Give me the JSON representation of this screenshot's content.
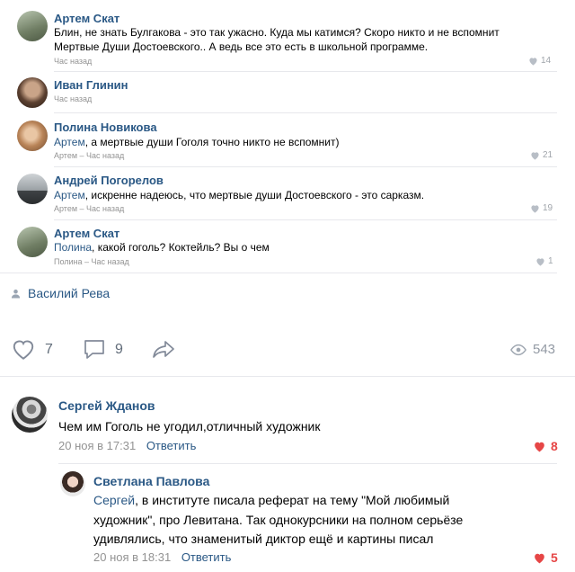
{
  "thread": [
    {
      "author": "Артем Скат",
      "text_line1": "Блин, не знать Булгакова - это так ужасно. Куда мы катимся? Скоро никто и не вспомнит",
      "text_line2": "Мертвые Души Достоевского.. А ведь все это есть в школьной программе.",
      "meta": "Час назад",
      "likes": "14"
    },
    {
      "author": "Иван Глинин",
      "meta": "Час назад"
    },
    {
      "author": "Полина Новикова",
      "reply_to": "Артем",
      "text": ", а мертвые души Гоголя точно никто не вспомнит)",
      "meta": "Артем – Час назад",
      "likes": "21"
    },
    {
      "author": "Андрей Погорелов",
      "reply_to": "Артем",
      "text": ", искренне надеюсь, что мертвые души Достоевского - это сарказм.",
      "meta": "Артем – Час назад",
      "likes": "19"
    },
    {
      "author": "Артем Скат",
      "reply_to": "Полина",
      "text": ", какой гоголь? Коктейль? Вы о чем",
      "meta": "Полина – Час назад",
      "likes": "1"
    }
  ],
  "post_author": "Василий Рева",
  "post_actions": {
    "likes": "7",
    "comments": "9",
    "views": "543"
  },
  "comments": [
    {
      "author": "Сергей Жданов",
      "text": "Чем им Гоголь не угодил,отличный художник",
      "date": "20 ноя в 17:31",
      "reply_label": "Ответить",
      "likes": "8"
    },
    {
      "author": "Светлана Павлова",
      "reply_to": "Сергей",
      "text_line1": ", в институте писала реферат на тему \"Мой любимый",
      "text_line2": "художник\", про Левитана. Так однокурсники на полном серьёзе",
      "text_line3": "удивлялись, что знаменитый диктор ещё и картины писал",
      "date": "20 ноя в 18:31",
      "reply_label": "Ответить",
      "likes": "5"
    }
  ],
  "colors": {
    "link": "#2a5885",
    "muted": "#939393",
    "heart_active": "#e64646",
    "separator": "#e7e8ec"
  }
}
